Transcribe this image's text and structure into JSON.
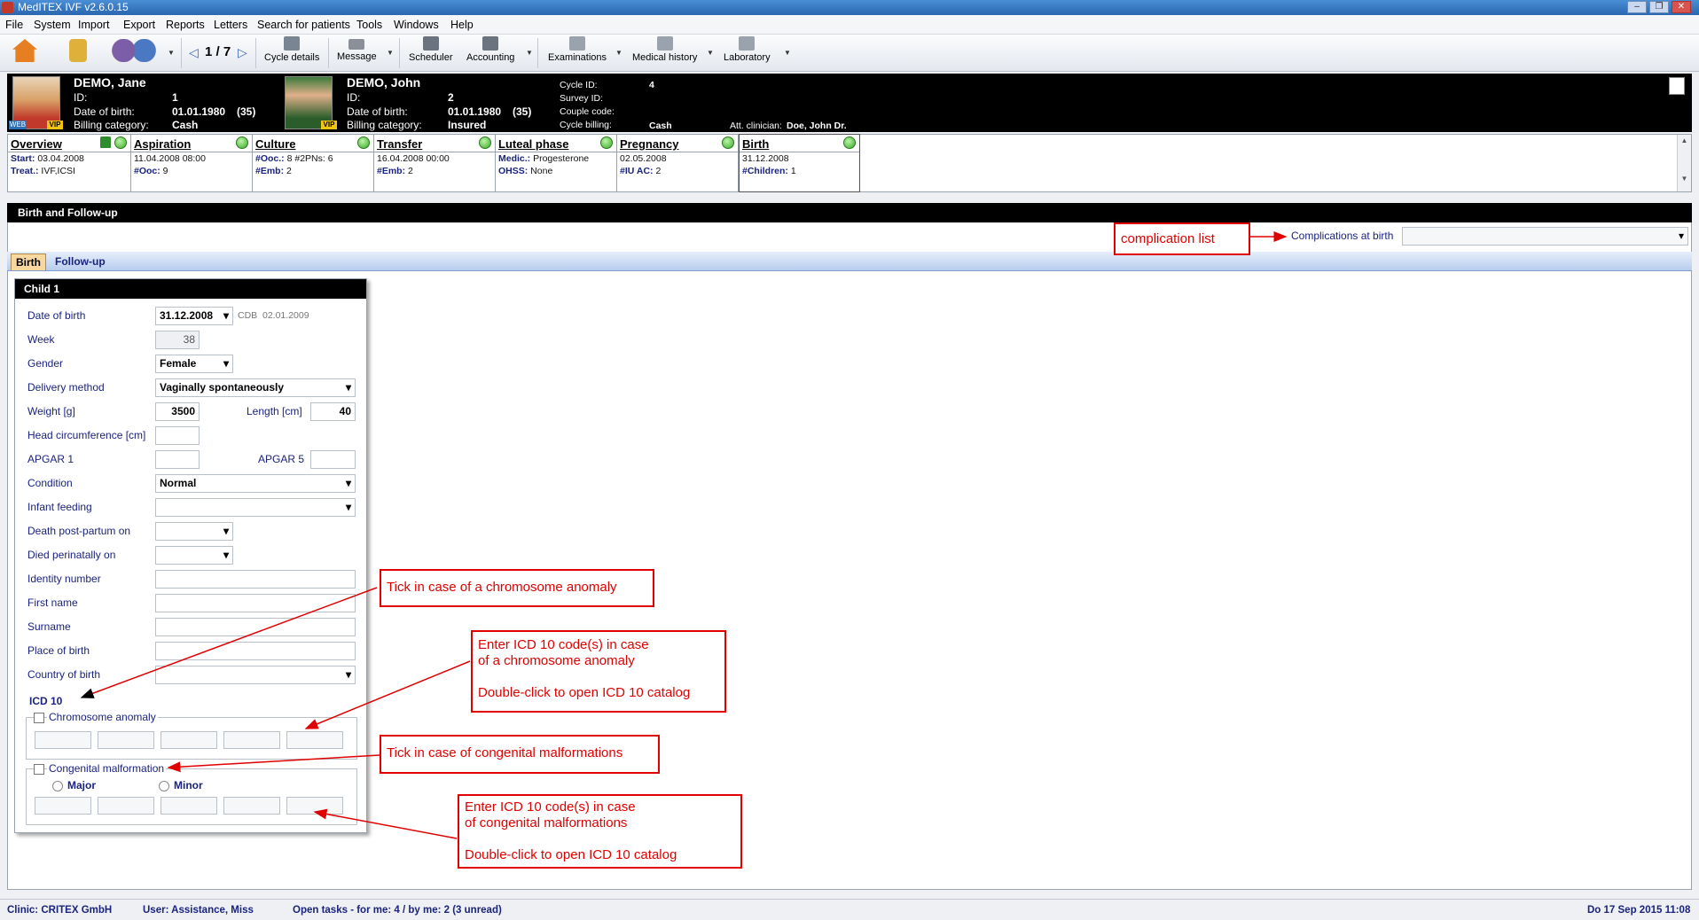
{
  "window": {
    "title": "MedITEX IVF v2.6.0.15"
  },
  "menu": [
    "File",
    "System",
    "Import",
    "Export",
    "Reports",
    "Letters",
    "Search for patients",
    "Tools",
    "Windows",
    "Help"
  ],
  "toolbar": {
    "pager": "1 / 7",
    "cycle_details": "Cycle details",
    "message": "Message",
    "scheduler": "Scheduler",
    "accounting": "Accounting",
    "examinations": "Examinations",
    "medical_history": "Medical history",
    "laboratory": "Laboratory"
  },
  "patient_female": {
    "name": "DEMO, Jane",
    "id_label": "ID:",
    "id": "1",
    "dob_label": "Date of birth:",
    "dob": "01.01.1980",
    "age": "(35)",
    "billing_label": "Billing category:",
    "billing": "Cash",
    "badge_web": "WEB",
    "badge_vip": "VIP"
  },
  "patient_male": {
    "name": "DEMO, John",
    "id_label": "ID:",
    "id": "2",
    "dob_label": "Date of birth:",
    "dob": "01.01.1980",
    "age": "(35)",
    "billing_label": "Billing category:",
    "billing": "Insured",
    "badge_vip": "VIP"
  },
  "cycle_info": {
    "cycle_id_label": "Cycle ID:",
    "cycle_id": "4",
    "survey_id_label": "Survey ID:",
    "couple_code_label": "Couple code:",
    "cycle_billing_label": "Cycle billing:",
    "cycle_billing": "Cash",
    "clinician_label": "Att. clinician:",
    "clinician": "Doe, John Dr."
  },
  "cycle_tabs": [
    {
      "title": "Overview",
      "l1k": "Start:",
      "l1v": " 03.04.2008",
      "l2k": "Treat.:",
      "l2v": " IVF,ICSI"
    },
    {
      "title": "Aspiration",
      "l1k": "",
      "l1v": "11.04.2008 08:00",
      "l2k": "#Ooc:",
      "l2v": " 9"
    },
    {
      "title": "Culture",
      "l1k": "#Ooc.:",
      "l1v": " 8 #2PNs: 6",
      "l2k": "#Emb:",
      "l2v": " 2"
    },
    {
      "title": "Transfer",
      "l1k": "",
      "l1v": "16.04.2008 00:00",
      "l2k": "#Emb:",
      "l2v": " 2"
    },
    {
      "title": "Luteal phase",
      "l1k": "Medic.:",
      "l1v": " Progesterone",
      "l2k": "OHSS:",
      "l2v": " None"
    },
    {
      "title": "Pregnancy",
      "l1k": "",
      "l1v": "02.05.2008",
      "l2k": "#IU AC:",
      "l2v": " 2"
    },
    {
      "title": "Birth",
      "l1k": "",
      "l1v": "31.12.2008",
      "l2k": "#Children:",
      "l2v": " 1"
    }
  ],
  "panel": {
    "title": "Birth and Follow-up",
    "complications_label": "Complications at birth",
    "complications_value": "",
    "subtabs": [
      "Birth",
      "Follow-up"
    ]
  },
  "child": {
    "title": "Child 1",
    "date_of_birth_label": "Date of birth",
    "date_of_birth": "31.12.2008",
    "cdb_label": "CDB",
    "cdb": "02.01.2009",
    "week_label": "Week",
    "week": "38",
    "gender_label": "Gender",
    "gender": "Female",
    "delivery_label": "Delivery method",
    "delivery": "Vaginally spontaneously",
    "weight_label": "Weight [g]",
    "weight": "3500",
    "length_label": "Length [cm]",
    "length": "40",
    "head_label": "Head circumference [cm]",
    "head": "",
    "apgar1_label": "APGAR 1",
    "apgar1": "",
    "apgar5_label": "APGAR 5",
    "apgar5": "",
    "condition_label": "Condition",
    "condition": "Normal",
    "feeding_label": "Infant feeding",
    "feeding": "",
    "death_label": "Death post-partum on",
    "death": "",
    "perinatal_label": "Died perinatally on",
    "perinatal": "",
    "identity_label": "Identity number",
    "identity": "",
    "firstname_label": "First name",
    "firstname": "",
    "surname_label": "Surname",
    "surname": "",
    "place_label": "Place of birth",
    "place": "",
    "country_label": "Country of birth",
    "country": "",
    "icd_title": "ICD 10",
    "chromosome_label": "Chromosome anomaly",
    "malformation_label": "Congenital malformation",
    "major_label": "Major",
    "minor_label": "Minor"
  },
  "annotations": {
    "complication": "complication list",
    "tick_chromosome": "Tick in case of a chromosome anomaly",
    "icd_chromosome_1": "Enter ICD 10 code(s) in case",
    "icd_chromosome_2": "of a chromosome anomaly",
    "icd_chromosome_3": "Double-click to open ICD 10 catalog",
    "tick_malformation": "Tick in case of congenital malformations",
    "icd_malformation_1": "Enter ICD 10 code(s) in case",
    "icd_malformation_2": "of congenital malformations",
    "icd_malformation_3": "Double-click to open ICD 10 catalog"
  },
  "statusbar": {
    "clinic": "Clinic: CRITEX GmbH",
    "user": "User: Assistance, Miss",
    "tasks": "Open tasks - for me: 4 / by me: 2  (3 unread)",
    "datetime": "Do 17 Sep 2015 11:08"
  }
}
